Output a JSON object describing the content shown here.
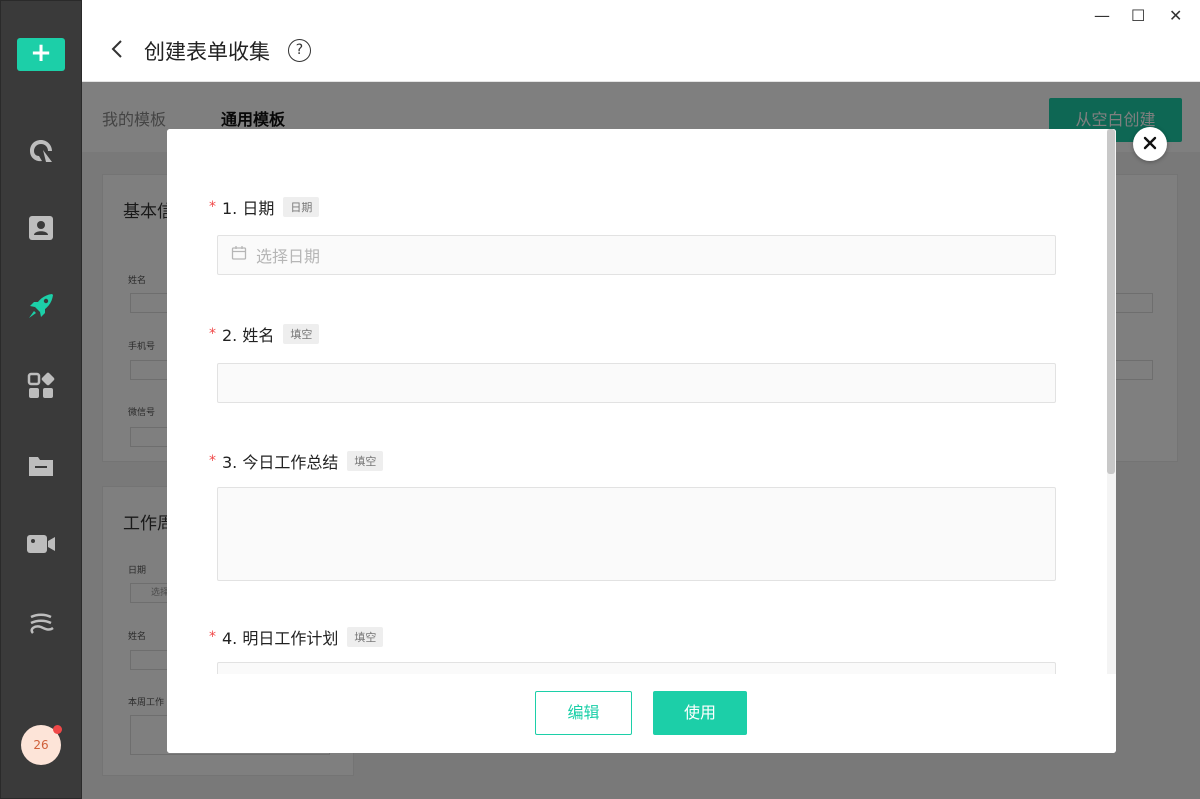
{
  "sidebar": {
    "add_label": "+",
    "avatar_count": "26",
    "icons": [
      "logo-icon",
      "contact-icon",
      "rocket-icon",
      "apps-icon",
      "folder-icon",
      "video-icon",
      "cloud-icon"
    ]
  },
  "header": {
    "title": "创建表单收集",
    "help": "?",
    "window_controls": {
      "minimize": "—",
      "maximize": "☐",
      "close": "✕"
    }
  },
  "tabs": {
    "mine": "我的模板",
    "common": "通用模板",
    "blank_button": "从空白创建"
  },
  "background_cards": {
    "card1_title": "基本信",
    "card1_fields": [
      "姓名",
      "手机号",
      "微信号"
    ],
    "card2_title": "工作周",
    "card2_fields": [
      "日期",
      "姓名",
      "本周工作"
    ],
    "card2_date_placeholder": "选择"
  },
  "modal": {
    "questions": [
      {
        "label": "1. 日期",
        "tag": "日期"
      },
      {
        "label": "2. 姓名",
        "tag": "填空"
      },
      {
        "label": "3. 今日工作总结",
        "tag": "填空"
      },
      {
        "label": "4. 明日工作计划",
        "tag": "填空"
      }
    ],
    "date_placeholder": "选择日期",
    "edit_button": "编辑",
    "use_button": "使用",
    "required_mark": "*"
  },
  "colors": {
    "accent": "#1ccfa8",
    "sidebar": "#3a3a3a",
    "required": "#f04848"
  }
}
